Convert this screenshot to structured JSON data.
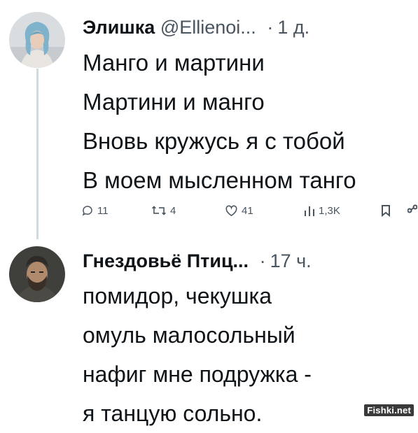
{
  "tweet1": {
    "display_name": "Элишка",
    "handle": "@Ellienoi...",
    "separator": "·",
    "time": "1 д.",
    "lines": [
      "Манго и мартини",
      "Мартини и манго",
      "Вновь кружусь я с тобой",
      "В моем мысленном танго"
    ],
    "stats": {
      "replies": "11",
      "retweets": "4",
      "likes": "41",
      "views": "1,3K"
    }
  },
  "tweet2": {
    "display_name": "Гнездовьё Птиц...",
    "separator": "·",
    "time": "17 ч.",
    "lines": [
      "помидор, чекушка",
      "омуль малосольный",
      "нафиг мне подружка -",
      "я танцую сольно."
    ]
  },
  "watermark": "Fishki.net",
  "colors": {
    "text": "#0f1419",
    "secondary": "#4a5560",
    "thread_line": "#cfd9de"
  },
  "icons": [
    "reply-icon",
    "retweet-icon",
    "like-icon",
    "views-icon",
    "bookmark-icon",
    "share-icon"
  ]
}
